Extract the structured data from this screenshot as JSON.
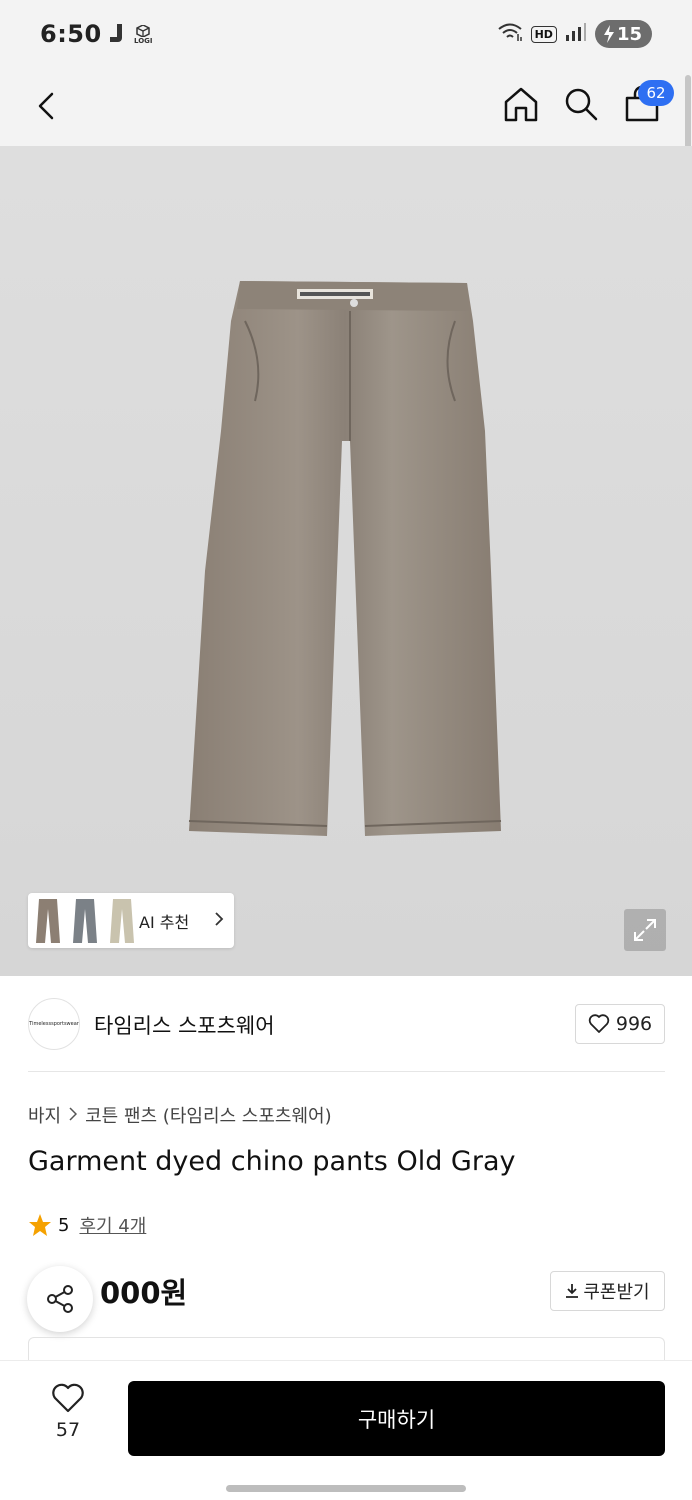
{
  "status_bar": {
    "time": "6:50",
    "battery": "15",
    "hd": "HD",
    "logi_label": "LOGI"
  },
  "header": {
    "cart_count": "62",
    "icons": [
      "back-arrow-icon",
      "home-icon",
      "search-icon",
      "bag-icon"
    ]
  },
  "gallery": {
    "ai_label": "AI 추천",
    "thumb_colors": [
      "#8c7f73",
      "#7b8187",
      "#c9c3ae"
    ]
  },
  "brand": {
    "logo_text": "Timelesssportswear",
    "name": "타임리스 스포츠웨어",
    "likes": "996"
  },
  "product": {
    "breadcrumb": [
      "바지",
      "코튼 팬츠 (타임리스 스포츠웨어)"
    ],
    "title": "Garment dyed chino pants Old Gray",
    "rating": "5",
    "reviews": "후기 4개",
    "price": "000원",
    "coupon": "쿠폰받기"
  },
  "bottom_bar": {
    "wish_count": "57",
    "buy_label": "구매하기"
  },
  "colors": {
    "badge_blue": "#2e6ff2",
    "star_orange": "#f5a100",
    "buy_black": "#000000"
  }
}
